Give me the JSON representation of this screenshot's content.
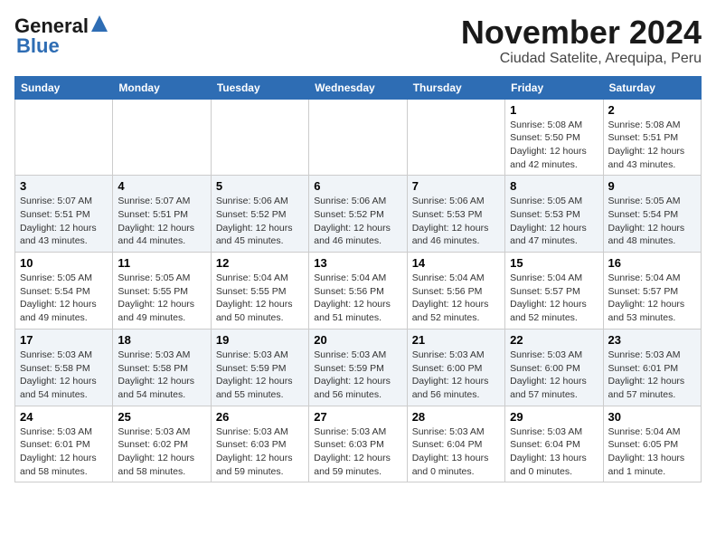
{
  "header": {
    "logo_general": "General",
    "logo_blue": "Blue",
    "month_year": "November 2024",
    "location": "Ciudad Satelite, Arequipa, Peru"
  },
  "weekdays": [
    "Sunday",
    "Monday",
    "Tuesday",
    "Wednesday",
    "Thursday",
    "Friday",
    "Saturday"
  ],
  "weeks": [
    [
      {
        "day": "",
        "info": ""
      },
      {
        "day": "",
        "info": ""
      },
      {
        "day": "",
        "info": ""
      },
      {
        "day": "",
        "info": ""
      },
      {
        "day": "",
        "info": ""
      },
      {
        "day": "1",
        "info": "Sunrise: 5:08 AM\nSunset: 5:50 PM\nDaylight: 12 hours\nand 42 minutes."
      },
      {
        "day": "2",
        "info": "Sunrise: 5:08 AM\nSunset: 5:51 PM\nDaylight: 12 hours\nand 43 minutes."
      }
    ],
    [
      {
        "day": "3",
        "info": "Sunrise: 5:07 AM\nSunset: 5:51 PM\nDaylight: 12 hours\nand 43 minutes."
      },
      {
        "day": "4",
        "info": "Sunrise: 5:07 AM\nSunset: 5:51 PM\nDaylight: 12 hours\nand 44 minutes."
      },
      {
        "day": "5",
        "info": "Sunrise: 5:06 AM\nSunset: 5:52 PM\nDaylight: 12 hours\nand 45 minutes."
      },
      {
        "day": "6",
        "info": "Sunrise: 5:06 AM\nSunset: 5:52 PM\nDaylight: 12 hours\nand 46 minutes."
      },
      {
        "day": "7",
        "info": "Sunrise: 5:06 AM\nSunset: 5:53 PM\nDaylight: 12 hours\nand 46 minutes."
      },
      {
        "day": "8",
        "info": "Sunrise: 5:05 AM\nSunset: 5:53 PM\nDaylight: 12 hours\nand 47 minutes."
      },
      {
        "day": "9",
        "info": "Sunrise: 5:05 AM\nSunset: 5:54 PM\nDaylight: 12 hours\nand 48 minutes."
      }
    ],
    [
      {
        "day": "10",
        "info": "Sunrise: 5:05 AM\nSunset: 5:54 PM\nDaylight: 12 hours\nand 49 minutes."
      },
      {
        "day": "11",
        "info": "Sunrise: 5:05 AM\nSunset: 5:55 PM\nDaylight: 12 hours\nand 49 minutes."
      },
      {
        "day": "12",
        "info": "Sunrise: 5:04 AM\nSunset: 5:55 PM\nDaylight: 12 hours\nand 50 minutes."
      },
      {
        "day": "13",
        "info": "Sunrise: 5:04 AM\nSunset: 5:56 PM\nDaylight: 12 hours\nand 51 minutes."
      },
      {
        "day": "14",
        "info": "Sunrise: 5:04 AM\nSunset: 5:56 PM\nDaylight: 12 hours\nand 52 minutes."
      },
      {
        "day": "15",
        "info": "Sunrise: 5:04 AM\nSunset: 5:57 PM\nDaylight: 12 hours\nand 52 minutes."
      },
      {
        "day": "16",
        "info": "Sunrise: 5:04 AM\nSunset: 5:57 PM\nDaylight: 12 hours\nand 53 minutes."
      }
    ],
    [
      {
        "day": "17",
        "info": "Sunrise: 5:03 AM\nSunset: 5:58 PM\nDaylight: 12 hours\nand 54 minutes."
      },
      {
        "day": "18",
        "info": "Sunrise: 5:03 AM\nSunset: 5:58 PM\nDaylight: 12 hours\nand 54 minutes."
      },
      {
        "day": "19",
        "info": "Sunrise: 5:03 AM\nSunset: 5:59 PM\nDaylight: 12 hours\nand 55 minutes."
      },
      {
        "day": "20",
        "info": "Sunrise: 5:03 AM\nSunset: 5:59 PM\nDaylight: 12 hours\nand 56 minutes."
      },
      {
        "day": "21",
        "info": "Sunrise: 5:03 AM\nSunset: 6:00 PM\nDaylight: 12 hours\nand 56 minutes."
      },
      {
        "day": "22",
        "info": "Sunrise: 5:03 AM\nSunset: 6:00 PM\nDaylight: 12 hours\nand 57 minutes."
      },
      {
        "day": "23",
        "info": "Sunrise: 5:03 AM\nSunset: 6:01 PM\nDaylight: 12 hours\nand 57 minutes."
      }
    ],
    [
      {
        "day": "24",
        "info": "Sunrise: 5:03 AM\nSunset: 6:01 PM\nDaylight: 12 hours\nand 58 minutes."
      },
      {
        "day": "25",
        "info": "Sunrise: 5:03 AM\nSunset: 6:02 PM\nDaylight: 12 hours\nand 58 minutes."
      },
      {
        "day": "26",
        "info": "Sunrise: 5:03 AM\nSunset: 6:03 PM\nDaylight: 12 hours\nand 59 minutes."
      },
      {
        "day": "27",
        "info": "Sunrise: 5:03 AM\nSunset: 6:03 PM\nDaylight: 12 hours\nand 59 minutes."
      },
      {
        "day": "28",
        "info": "Sunrise: 5:03 AM\nSunset: 6:04 PM\nDaylight: 13 hours\nand 0 minutes."
      },
      {
        "day": "29",
        "info": "Sunrise: 5:03 AM\nSunset: 6:04 PM\nDaylight: 13 hours\nand 0 minutes."
      },
      {
        "day": "30",
        "info": "Sunrise: 5:04 AM\nSunset: 6:05 PM\nDaylight: 13 hours\nand 1 minute."
      }
    ]
  ]
}
